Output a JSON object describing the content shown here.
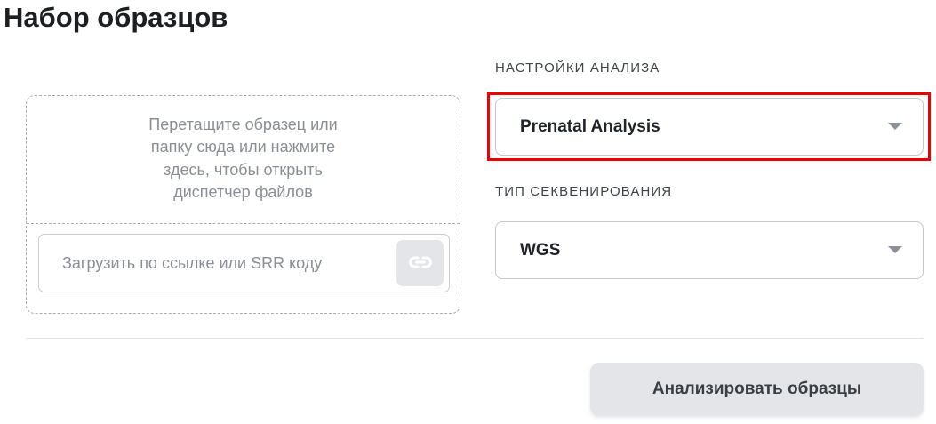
{
  "page": {
    "title": "Набор образцов"
  },
  "upload": {
    "dropzone_text": "Перетащите образец или папку сюда или нажмите здесь, чтобы открыть диспетчер файлов",
    "url_placeholder": "Загрузить по ссылке или SRR коду",
    "url_value": "",
    "link_button_icon": "link-icon"
  },
  "analysis_settings": {
    "label": "НАСТРОЙКИ АНАЛИЗА",
    "selected": "Prenatal Analysis",
    "highlight_color": "#ee0000"
  },
  "sequencing_type": {
    "label": "ТИП СЕКВЕНИРОВАНИЯ",
    "selected": "WGS"
  },
  "actions": {
    "analyze_label": "Анализировать образцы"
  },
  "colors": {
    "button_bg": "#e3e5e9",
    "muted_text": "#8a8f96",
    "border": "#c5c8cd"
  }
}
